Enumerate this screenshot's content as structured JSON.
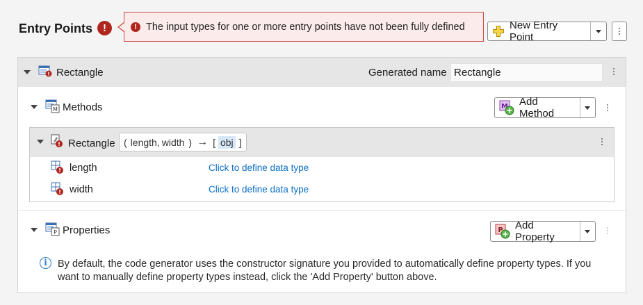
{
  "header": {
    "title": "Entry Points",
    "error_badge": "!",
    "tooltip_message": "The input types for one or more entry points have not been fully defined",
    "new_entry_point_label": "New Entry Point"
  },
  "entry": {
    "name": "Rectangle",
    "generated_name_label": "Generated name",
    "generated_name_value": "Rectangle"
  },
  "methods": {
    "section_label": "Methods",
    "add_method_label": "Add Method",
    "method": {
      "name": "Rectangle",
      "signature": {
        "open_paren": "(",
        "inputs": [
          "length",
          "width"
        ],
        "close_paren": ")",
        "arrow": "→",
        "open_bracket": "[",
        "output": "obj",
        "close_bracket": "]"
      },
      "args": [
        {
          "name": "length",
          "type_link": "Click to define data type"
        },
        {
          "name": "width",
          "type_link": "Click to define data type"
        }
      ]
    }
  },
  "properties": {
    "section_label": "Properties",
    "add_property_label": "Add Property",
    "info_text": "By default, the code generator uses the constructor signature you provided to automatically define property types. If you want to manually define property types instead, click the 'Add Property' button above."
  },
  "colors": {
    "error": "#b0261d",
    "link": "#0b6ec7",
    "info": "#2b7cc9",
    "band": "#e6e6e6"
  }
}
